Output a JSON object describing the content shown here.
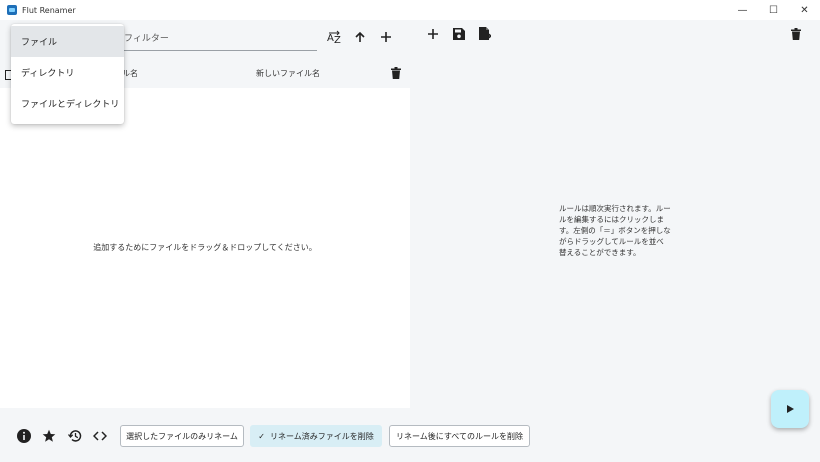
{
  "window": {
    "title": "Flut Renamer",
    "minimize": "—",
    "maximize": "☐",
    "close": "✕"
  },
  "left": {
    "filter_placeholder": "フィルター",
    "columns": {
      "filename_partial": "ル名",
      "new_filename": "新しいファイル名"
    },
    "empty_message": "追加するためにファイルをドラッグ＆ドロップしてください。",
    "toolbar": {
      "sort_icon": "sort-az-icon",
      "up_icon": "arrow-up-icon",
      "add_icon": "plus-icon"
    }
  },
  "dropdown": {
    "items": [
      {
        "label": "ファイル",
        "selected": true
      },
      {
        "label": "ディレクトリ",
        "selected": false
      },
      {
        "label": "ファイルとディレクトリ",
        "selected": false
      }
    ]
  },
  "right": {
    "toolbar": [
      "plus-icon",
      "save-icon",
      "file-export-icon"
    ],
    "info": "ルールは順次実行されます。ルールを編集するにはクリックします。左側の「＝」ボタンを押しながらドラッグしてルールを並べ替えることができます。"
  },
  "bottom": {
    "icons": [
      "info-icon",
      "star-icon",
      "history-icon",
      "code-icon"
    ],
    "buttons": {
      "rename_selected": "選択したファイルのみリネーム",
      "remove_renamed": "リネーム済みファイルを削除",
      "clear_rules": "リネーム後にすべてのルールを削除"
    }
  },
  "colors": {
    "background": "#f4f6f8",
    "panel": "#ffffff",
    "accent_fab": "#bff0fb",
    "toggled": "#d8eef5"
  }
}
